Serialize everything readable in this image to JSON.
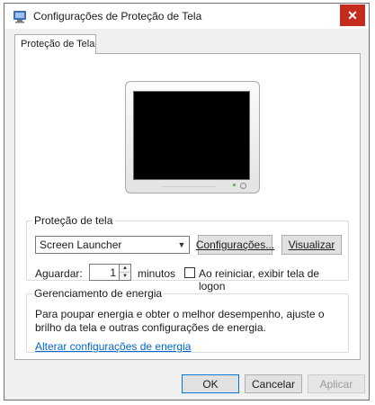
{
  "window": {
    "title": "Configurações de Proteção de Tela",
    "close_glyph": "✕"
  },
  "tabs": [
    {
      "label": "Proteção de Tela"
    }
  ],
  "screensaver": {
    "group_label": "Proteção de tela",
    "selected": "Screen Launcher",
    "settings_label": "Configurações...",
    "preview_label": "Visualizar",
    "wait_label": "Aguardar:",
    "wait_value": "1",
    "minutes_label": "minutos",
    "logon_checkbox_label": "Ao reiniciar, exibir tela de logon",
    "logon_checked": false
  },
  "power": {
    "group_label": "Gerenciamento de energia",
    "description": "Para poupar energia e obter o melhor desempenho, ajuste o brilho da tela e outras configurações de energia.",
    "link_label": "Alterar configurações de energia"
  },
  "footer": {
    "ok_label": "OK",
    "cancel_label": "Cancelar",
    "apply_label": "Aplicar"
  },
  "colors": {
    "close": "#c42b1c",
    "link": "#0066cc",
    "ok_border": "#0078d7"
  }
}
